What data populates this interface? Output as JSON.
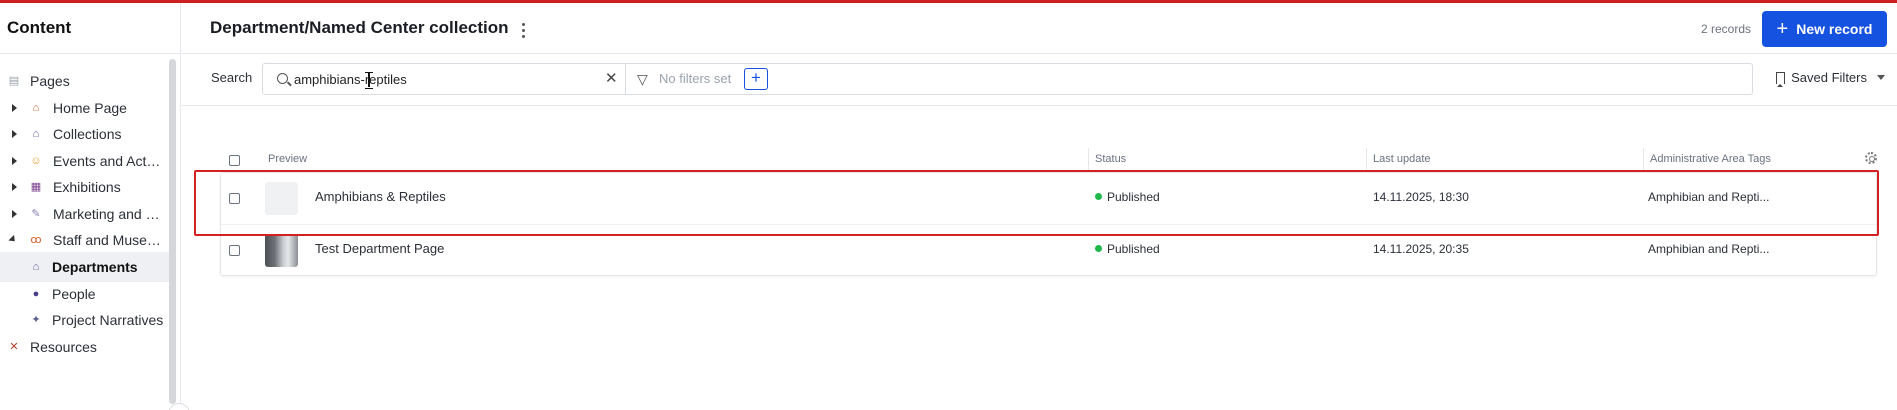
{
  "sidebar": {
    "title": "Content",
    "items": [
      {
        "label": "Pages",
        "icon": "page-icon"
      },
      {
        "label": "Home Page",
        "icon": "home-icon"
      },
      {
        "label": "Collections",
        "icon": "museum-icon"
      },
      {
        "label": "Events and Activ...",
        "icon": "theater-masks-icon"
      },
      {
        "label": "Exhibitions",
        "icon": "gallery-icon"
      },
      {
        "label": "Marketing and P...",
        "icon": "megaphone-icon"
      },
      {
        "label": "Staff and Museu...",
        "icon": "people-icon"
      },
      {
        "label": "Departments",
        "icon": "museum-icon"
      },
      {
        "label": "People",
        "icon": "person-icon"
      },
      {
        "label": "Project Narratives",
        "icon": "telescope-icon"
      },
      {
        "label": "Resources",
        "icon": "tools-icon"
      }
    ]
  },
  "header": {
    "title": "Department/Named Center collection",
    "record_count": "2 records",
    "new_record_label": "New record"
  },
  "filterbar": {
    "search_label": "Search",
    "search_value": "amphibians-reptiles",
    "no_filters": "No filters set",
    "saved_filters": "Saved Filters"
  },
  "table": {
    "columns": [
      "Preview",
      "Status",
      "Last update",
      "Administrative Area Tags"
    ],
    "rows": [
      {
        "name": "Amphibians & Reptiles",
        "status": "Published",
        "last_update": "14.11.2025, 18:30",
        "tags": "Amphibian and Repti..."
      },
      {
        "name": "Test Department Page",
        "status": "Published",
        "last_update": "14.11.2025, 20:35",
        "tags": "Amphibian and Repti..."
      }
    ]
  },
  "colors": {
    "accent": "#1552e0",
    "published": "#1fb84a",
    "highlight": "#d42020"
  }
}
